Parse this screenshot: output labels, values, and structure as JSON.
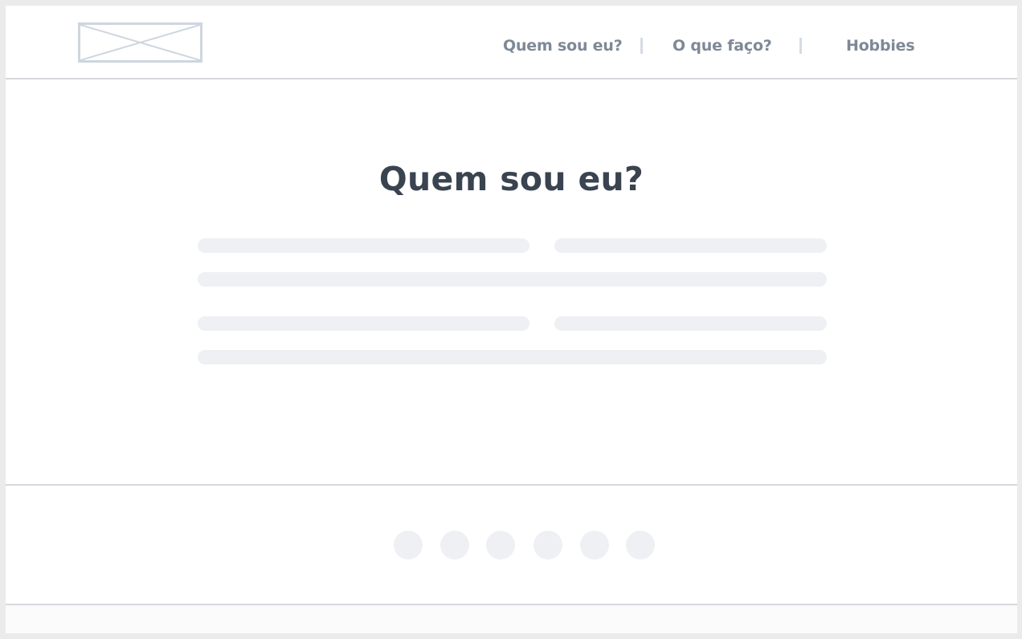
{
  "header": {
    "logo_icon": "image-placeholder-icon",
    "nav": [
      {
        "label": "Quem sou eu?"
      },
      {
        "label": "O que faço?"
      },
      {
        "label": "Hobbies"
      }
    ]
  },
  "main": {
    "title": "Quem sou eu?",
    "text_placeholder_lines": 6
  },
  "footer": {
    "social_icons": [
      "social-icon-placeholder",
      "social-icon-placeholder",
      "social-icon-placeholder",
      "social-icon-placeholder",
      "social-icon-placeholder",
      "social-icon-placeholder"
    ]
  },
  "colors": {
    "nav_text": "#7d8996",
    "title_text": "#3a4350",
    "placeholder": "#eef0f4",
    "divider": "#d5d8dc",
    "logo_border": "#ced6df"
  }
}
